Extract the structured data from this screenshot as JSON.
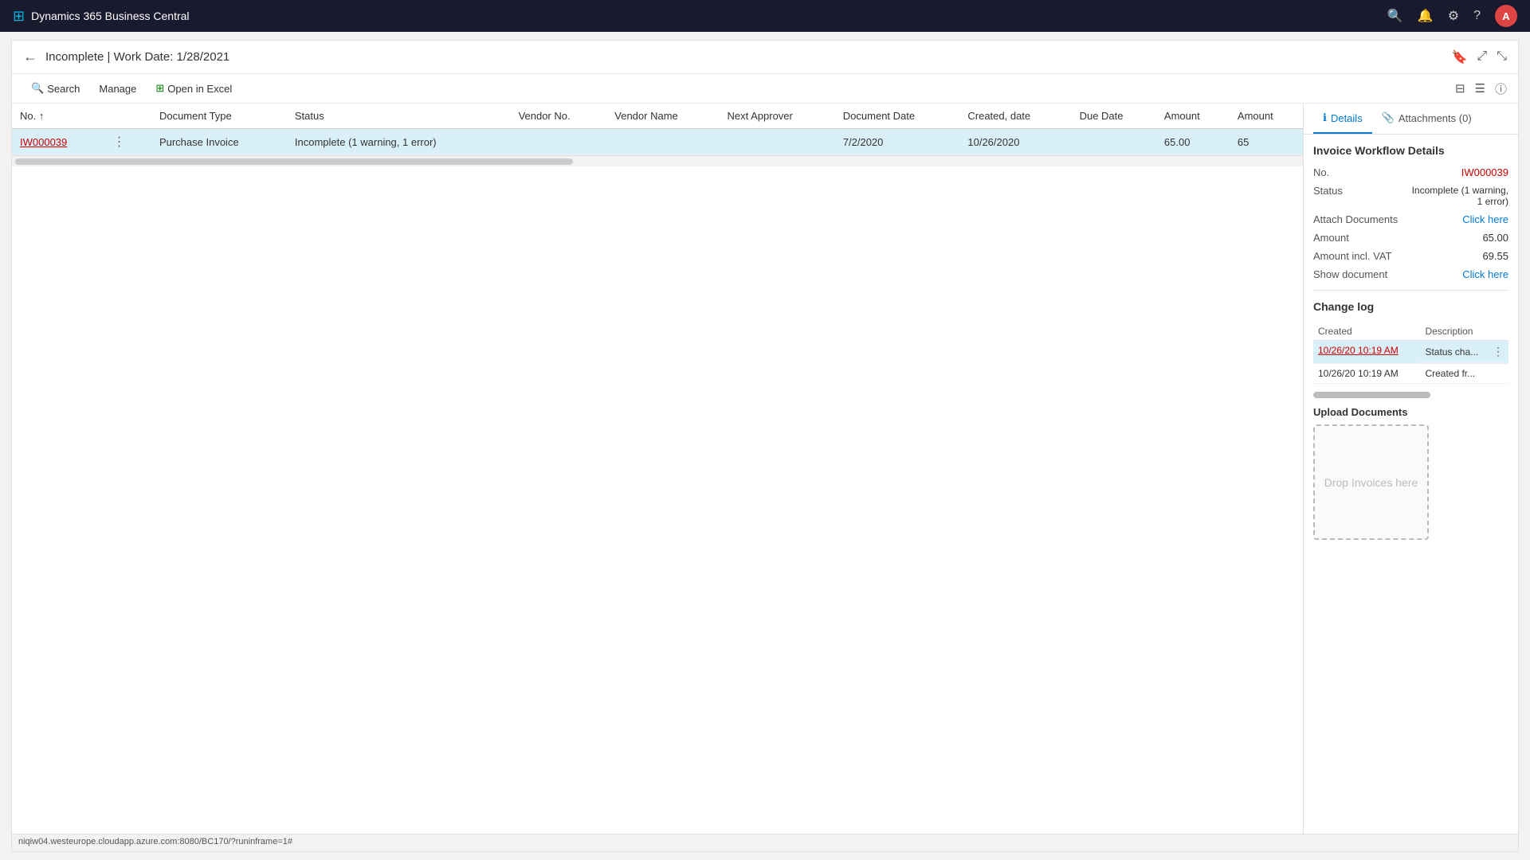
{
  "app": {
    "title": "Dynamics 365 Business Central"
  },
  "header": {
    "back_label": "←",
    "page_title": "Incomplete | Work Date: 1/28/2021",
    "bookmark_icon": "🔖",
    "share_icon": "⤢",
    "expand_icon": "⤡"
  },
  "toolbar": {
    "search_label": "Search",
    "manage_label": "Manage",
    "open_excel_label": "Open in Excel",
    "filter_icon": "filter",
    "list_icon": "list",
    "info_icon": "info"
  },
  "table": {
    "columns": [
      "No. ↑",
      "Document Type",
      "Status",
      "Vendor No.",
      "Vendor Name",
      "Next Approver",
      "Document Date",
      "Created, date",
      "Due Date",
      "Amount",
      "Amount"
    ],
    "rows": [
      {
        "no": "IW000039",
        "document_type": "Purchase Invoice",
        "status": "Incomplete (1 warning, 1 error)",
        "vendor_no": "",
        "vendor_name": "",
        "next_approver": "",
        "document_date": "7/2/2020",
        "created_date": "10/26/2020",
        "due_date": "",
        "amount": "65.00",
        "amount2": "65",
        "selected": true
      }
    ]
  },
  "right_panel": {
    "tabs": [
      {
        "id": "details",
        "label": "Details",
        "icon": "ℹ",
        "active": true
      },
      {
        "id": "attachments",
        "label": "Attachments (0)",
        "icon": "📎",
        "active": false
      }
    ],
    "details": {
      "section_title": "Invoice Workflow Details",
      "fields": [
        {
          "label": "No.",
          "value": "IW000039",
          "type": "link-red"
        },
        {
          "label": "Status",
          "value": "Incomplete (1 warning, 1 error)",
          "type": "text"
        },
        {
          "label": "Attach Documents",
          "value": "Click here",
          "type": "link"
        },
        {
          "label": "Amount",
          "value": "65.00",
          "type": "text"
        },
        {
          "label": "Amount incl. VAT",
          "value": "69.55",
          "type": "text"
        },
        {
          "label": "Show document",
          "value": "Click here",
          "type": "link"
        }
      ]
    },
    "changelog": {
      "section_title": "Change log",
      "columns": [
        "Created",
        "Description"
      ],
      "rows": [
        {
          "created": "10/26/20 10:19 AM",
          "description": "Status cha...",
          "selected": true
        },
        {
          "created": "10/26/20 10:19 AM",
          "description": "Created fr...",
          "selected": false
        }
      ]
    },
    "upload": {
      "section_title": "Upload Documents",
      "drop_zone_text": "Drop Invoices here"
    }
  },
  "status_bar": {
    "url": "niqiw04.westeurope.cloudapp.azure.com:8080/BC170/?runinframe=1#"
  }
}
